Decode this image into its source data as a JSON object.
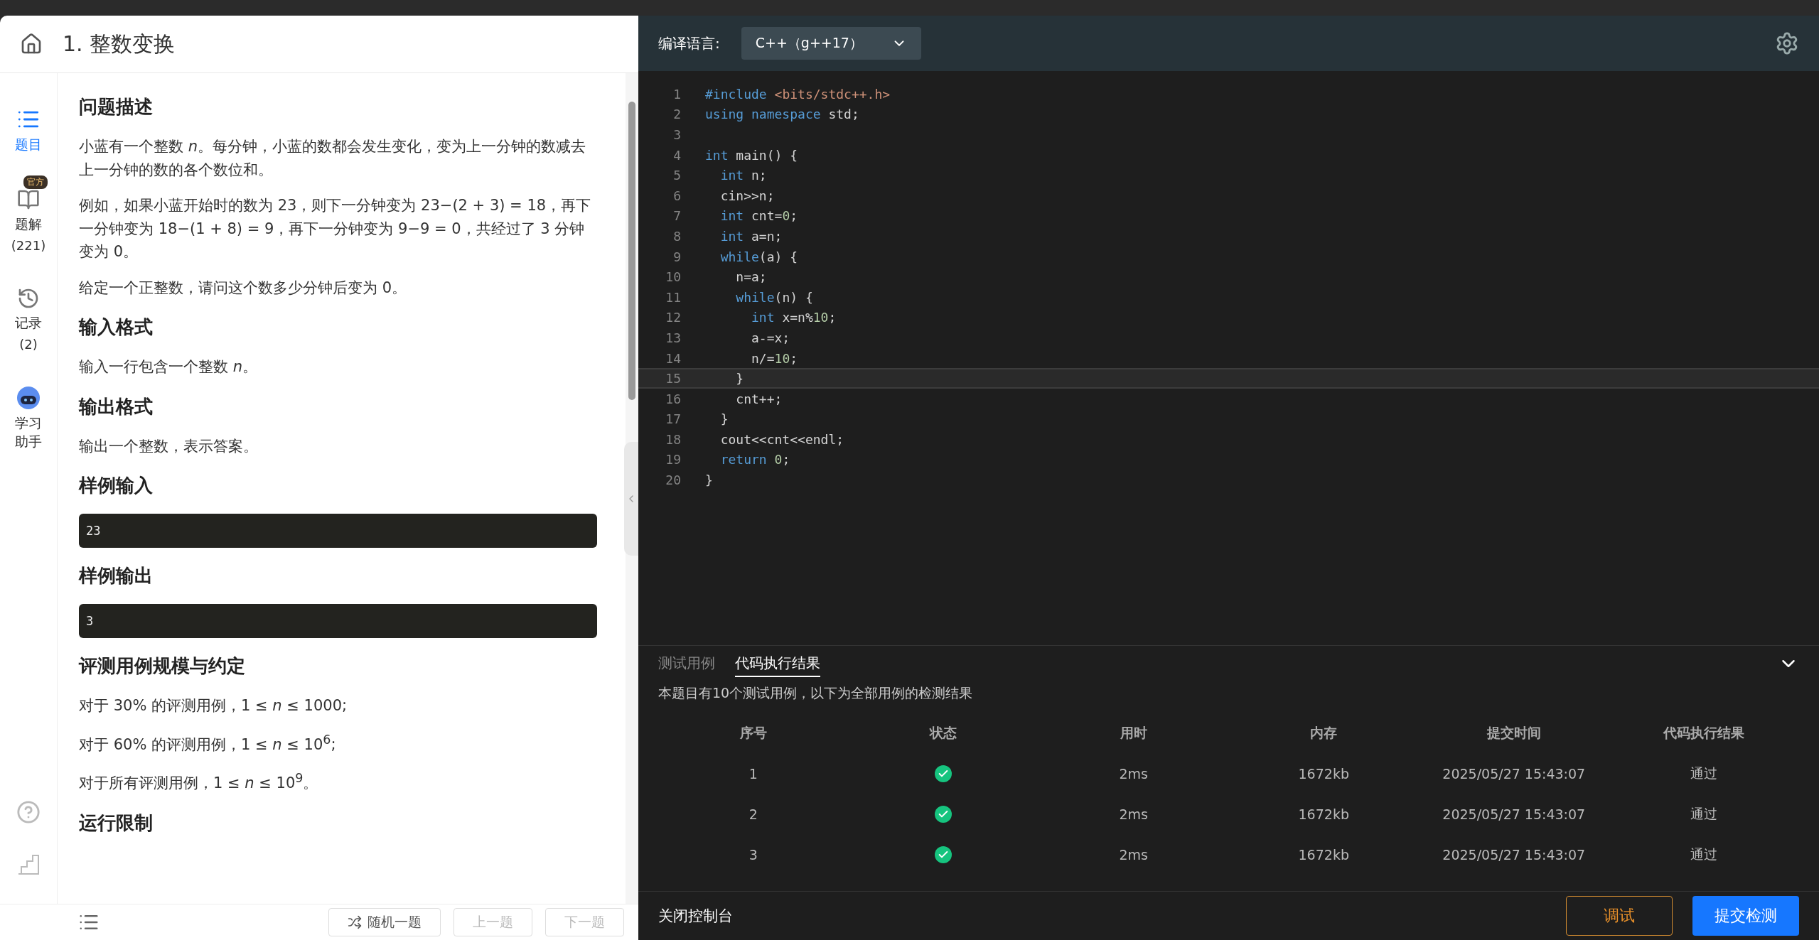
{
  "problem": {
    "title": "1. 整数变换",
    "nav": [
      {
        "label": "题目",
        "kind": "list",
        "selected": true
      },
      {
        "label": "题解",
        "count": "(221)",
        "badge": "官方",
        "kind": "book",
        "selected": false
      },
      {
        "label": "记录",
        "count": "(2)",
        "kind": "history",
        "selected": false
      },
      {
        "label": "学习助手",
        "kind": "robot",
        "selected": false
      }
    ],
    "sections": [
      {
        "kind": "text",
        "heading": "问题描述",
        "paragraphs": [
          "小蓝有一个整数 *n*。每分钟，小蓝的数都会发生变化，变为上一分钟的数减去上一分钟的数的各个数位和。",
          "例如，如果小蓝开始时的数为 23，则下一分钟变为 23−(2 + 3) = 18，再下一分钟变为 18−(1 + 8) = 9，再下一分钟变为 9−9 = 0，共经过了 3 分钟变为 0。",
          "给定一个正整数，请问这个数多少分钟后变为 0。"
        ]
      },
      {
        "kind": "text",
        "heading": "输入格式",
        "paragraphs": [
          "输入一行包含一个整数 *n*。"
        ]
      },
      {
        "kind": "text",
        "heading": "输出格式",
        "paragraphs": [
          "输出一个整数，表示答案。"
        ]
      },
      {
        "kind": "code",
        "heading": "样例输入",
        "code": "23"
      },
      {
        "kind": "code",
        "heading": "样例输出",
        "code": "3"
      },
      {
        "kind": "text",
        "heading": "评测用例规模与约定",
        "paragraphs": [
          "对于 30% 的评测用例，1 ≤ *n* ≤ 1000;",
          "对于 60% 的评测用例，1 ≤ *n* ≤ 10$^{6}$;",
          "对于所有评测用例，1 ≤ *n* ≤ 10$^{9}$。"
        ]
      },
      {
        "kind": "heading",
        "heading": "运行限制"
      }
    ],
    "footer_buttons": [
      {
        "label": "随机一题",
        "kind": "shuffle",
        "disabled": false
      },
      {
        "label": "上一题",
        "disabled": true
      },
      {
        "label": "下一题",
        "disabled": true
      }
    ]
  },
  "editor": {
    "language_label": "编译语言:",
    "language": "C++（g++17）",
    "lines": [
      {
        "number": "1",
        "current": false,
        "tokens": [
          {
            "kind": "keyword",
            "text": "#include "
          },
          {
            "kind": "string",
            "text": "<bits/stdc++.h>"
          }
        ]
      },
      {
        "number": "2",
        "current": false,
        "tokens": [
          {
            "kind": "keyword",
            "text": "using namespace"
          },
          {
            "kind": "plain",
            "text": " std;"
          }
        ]
      },
      {
        "number": "3",
        "current": false
      },
      {
        "number": "4",
        "current": false,
        "tokens": [
          {
            "kind": "keyword",
            "text": "int"
          },
          {
            "kind": "plain",
            "text": " main() {"
          }
        ]
      },
      {
        "number": "5",
        "current": false,
        "tokens": [
          {
            "kind": "keyword",
            "text": "  int"
          },
          {
            "kind": "plain",
            "text": " n;"
          }
        ]
      },
      {
        "number": "6",
        "current": false,
        "tokens": [
          {
            "kind": "plain",
            "text": "  cin>>n;"
          }
        ]
      },
      {
        "number": "7",
        "current": false,
        "tokens": [
          {
            "kind": "keyword",
            "text": "  int"
          },
          {
            "kind": "plain",
            "text": " cnt="
          },
          {
            "kind": "number",
            "text": "0"
          },
          {
            "kind": "plain",
            "text": ";"
          }
        ]
      },
      {
        "number": "8",
        "current": false,
        "tokens": [
          {
            "kind": "keyword",
            "text": "  int"
          },
          {
            "kind": "plain",
            "text": " a=n;"
          }
        ]
      },
      {
        "number": "9",
        "current": false,
        "tokens": [
          {
            "kind": "keyword",
            "text": "  while"
          },
          {
            "kind": "plain",
            "text": "(a) {"
          }
        ]
      },
      {
        "number": "10",
        "current": false,
        "tokens": [
          {
            "kind": "plain",
            "text": "    n=a;"
          }
        ]
      },
      {
        "number": "11",
        "current": false,
        "tokens": [
          {
            "kind": "keyword",
            "text": "    while"
          },
          {
            "kind": "plain",
            "text": "(n) {"
          }
        ]
      },
      {
        "number": "12",
        "current": false,
        "tokens": [
          {
            "kind": "keyword",
            "text": "      int"
          },
          {
            "kind": "plain",
            "text": " x=n%"
          },
          {
            "kind": "number",
            "text": "10"
          },
          {
            "kind": "plain",
            "text": ";"
          }
        ]
      },
      {
        "number": "13",
        "current": false,
        "tokens": [
          {
            "kind": "plain",
            "text": "      a-=x;"
          }
        ]
      },
      {
        "number": "14",
        "current": false,
        "tokens": [
          {
            "kind": "plain",
            "text": "      n/="
          },
          {
            "kind": "number",
            "text": "10"
          },
          {
            "kind": "plain",
            "text": ";"
          }
        ]
      },
      {
        "number": "15",
        "current": true,
        "tokens": [
          {
            "kind": "plain",
            "text": "    }"
          }
        ]
      },
      {
        "number": "16",
        "current": false,
        "tokens": [
          {
            "kind": "plain",
            "text": "    cnt++;"
          }
        ]
      },
      {
        "number": "17",
        "current": false,
        "tokens": [
          {
            "kind": "plain",
            "text": "  }"
          }
        ]
      },
      {
        "number": "18",
        "current": false,
        "tokens": [
          {
            "kind": "plain",
            "text": "  cout<<cnt<<endl;"
          }
        ]
      },
      {
        "number": "19",
        "current": false,
        "tokens": [
          {
            "kind": "keyword",
            "text": "  return"
          },
          {
            "kind": "number",
            "text": " 0"
          },
          {
            "kind": "plain",
            "text": ";"
          }
        ]
      },
      {
        "number": "20",
        "current": false,
        "tokens": [
          {
            "kind": "plain",
            "text": "}"
          }
        ]
      }
    ]
  },
  "console": {
    "tabs": [
      {
        "label": "测试用例",
        "selected": false
      },
      {
        "label": "代码执行结果",
        "selected": true
      }
    ],
    "summary": "本题目有10个测试用例，以下为全部用例的检测结果",
    "columns": [
      "序号",
      "状态",
      "用时",
      "内存",
      "提交时间",
      "代码执行结果"
    ],
    "rows": [
      {
        "index": "1",
        "passed": true,
        "time": "2ms",
        "memory": "1672kb",
        "submitted": "2025/05/27 15:43:07",
        "result": "通过"
      },
      {
        "index": "2",
        "passed": true,
        "time": "2ms",
        "memory": "1672kb",
        "submitted": "2025/05/27 15:43:07",
        "result": "通过"
      },
      {
        "index": "3",
        "passed": true,
        "time": "2ms",
        "memory": "1672kb",
        "submitted": "2025/05/27 15:43:07",
        "result": "通过"
      }
    ],
    "close_label": "关闭控制台",
    "debug_button": "调试",
    "submit_button": "提交检测"
  }
}
